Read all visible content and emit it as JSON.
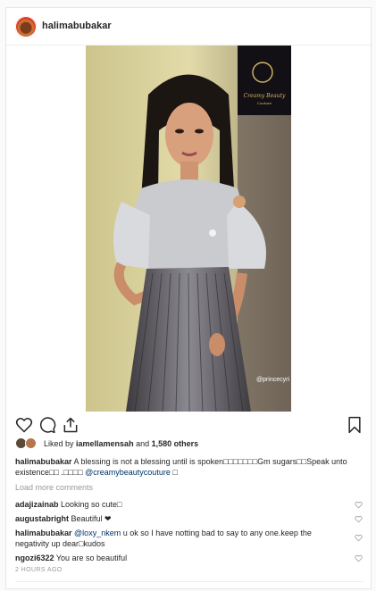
{
  "post": {
    "username": "halimabubakar",
    "photo_credit": "@princecyri",
    "brand_logo_text": "Creamy Beauty Couture"
  },
  "actions": {
    "like_icon": "heart-outline-icon",
    "comment_icon": "comment-bubble-icon",
    "share_icon": "share-icon",
    "save_icon": "bookmark-icon"
  },
  "likes": {
    "prefix": "Liked by ",
    "user": "iamellamensah",
    "middle": " and ",
    "count": "1,580 others"
  },
  "caption": {
    "author": "halimabubakar",
    "text": " A blessing is not a blessing until is spoken□□□□□□□Gm sugars□□Speak unto existence□□ .□□□□ ",
    "mention": "@creamybeautycouture",
    "tail": " □"
  },
  "load_more": "Load more comments",
  "comments": [
    {
      "user": "adajizainab",
      "text": " Looking so cute□"
    },
    {
      "user": "augustabright",
      "text": " Beautiful ❤"
    },
    {
      "user": "halimabubakar",
      "mention": "@loxy_nkem",
      "text": " u ok so I have notting bad to say to any one.keep the negativity up dear□kudos"
    },
    {
      "user": "ngozi6322",
      "text": " You are so beautiful"
    }
  ],
  "timestamp": "2 HOURS AGO",
  "colors": {
    "link": "#003569",
    "muted": "#999999",
    "border": "#efefef"
  }
}
